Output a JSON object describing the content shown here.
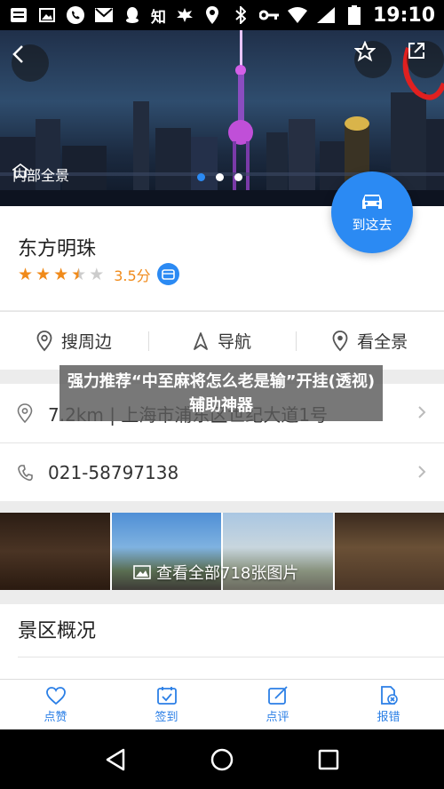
{
  "status_bar": {
    "time": "19:10",
    "zhihu_label": "知",
    "left_icons": [
      "notification-list-icon",
      "image-icon",
      "phone-icon",
      "mail-icon",
      "qq-icon",
      "zhihu-icon",
      "leaf-icon"
    ],
    "right_icons": [
      "location-icon",
      "bluetooth-icon",
      "key-icon",
      "wifi-icon",
      "signal-icon",
      "battery-icon"
    ]
  },
  "hero": {
    "panorama_label": "内部全景",
    "carousel_dots": 3,
    "active_dot": 0
  },
  "place": {
    "name": "东方明珠",
    "rating": 3.5,
    "rating_text": "3.5分",
    "goto_label": "到这去"
  },
  "actions": [
    {
      "label": "搜周边",
      "icon": "location-pin-icon"
    },
    {
      "label": "导航",
      "icon": "navigation-arrow-icon"
    },
    {
      "label": "看全景",
      "icon": "panorama-pin-icon"
    }
  ],
  "info": {
    "address": "7.2km | 上海市浦东区世纪大道1号",
    "phone": "021-58797138"
  },
  "photos": {
    "overlay_text": "查看全部718张图片"
  },
  "overview": {
    "title": "景区概况"
  },
  "tabs": [
    {
      "label": "点赞",
      "icon": "heart-icon"
    },
    {
      "label": "签到",
      "icon": "checkin-icon"
    },
    {
      "label": "点评",
      "icon": "edit-icon"
    },
    {
      "label": "报错",
      "icon": "report-icon"
    }
  ],
  "ad": {
    "text": "强力推荐“中至麻将怎么老是输”开挂(透视)辅助神器"
  },
  "colors": {
    "accent": "#2b8af3",
    "star": "#f08a1a"
  }
}
